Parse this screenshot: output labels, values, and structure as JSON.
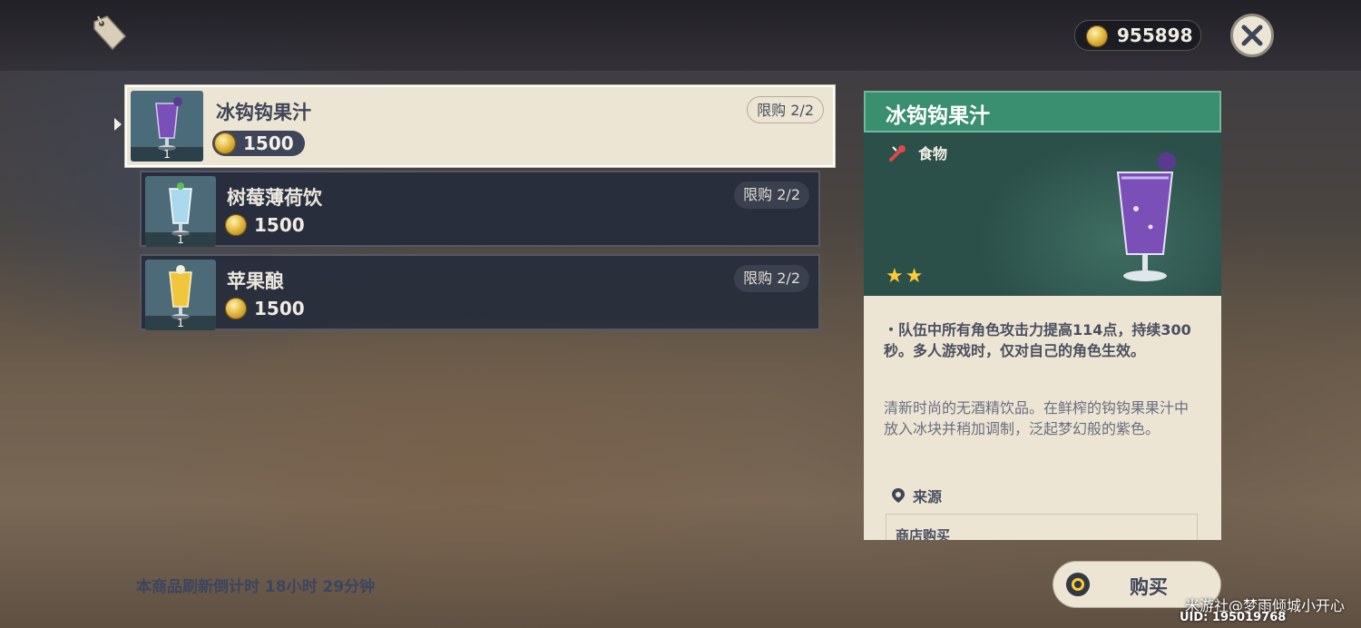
{
  "header": {
    "currency_amount": "955898"
  },
  "items": [
    {
      "name": "冰钩钩果汁",
      "price": "1500",
      "limit": "限购 2/2",
      "count": "1",
      "selected": true,
      "drink_color": "#7b4fb8"
    },
    {
      "name": "树莓薄荷饮",
      "price": "1500",
      "limit": "限购 2/2",
      "count": "1",
      "selected": false,
      "drink_color": "#a9d8ef"
    },
    {
      "name": "苹果酿",
      "price": "1500",
      "limit": "限购 2/2",
      "count": "1",
      "selected": false,
      "drink_color": "#f0c63c"
    }
  ],
  "detail": {
    "title": "冰钩钩果汁",
    "category": "食物",
    "stars": "★★",
    "rarity": 2,
    "effect": "・队伍中所有角色攻击力提高114点，持续300秒。多人游戏时，仅对自己的角色生效。",
    "description": "清新时尚的无酒精饮品。在鲜榨的钩钩果果汁中放入冰块并稍加调制，泛起梦幻般的紫色。",
    "source_label": "来源",
    "source_value": "商店购买"
  },
  "footer": {
    "refresh_text": "本商品刷新倒计时 18小时 29分钟",
    "buy_label": "购买",
    "watermark": "米游社@梦雨倾城小开心",
    "uid": "UID: 195019768"
  },
  "colors": {
    "accent_green": "#3a8f71",
    "panel_cream": "#ece5d4",
    "dark_text": "#3f4558",
    "gold": "#ffcb33"
  }
}
